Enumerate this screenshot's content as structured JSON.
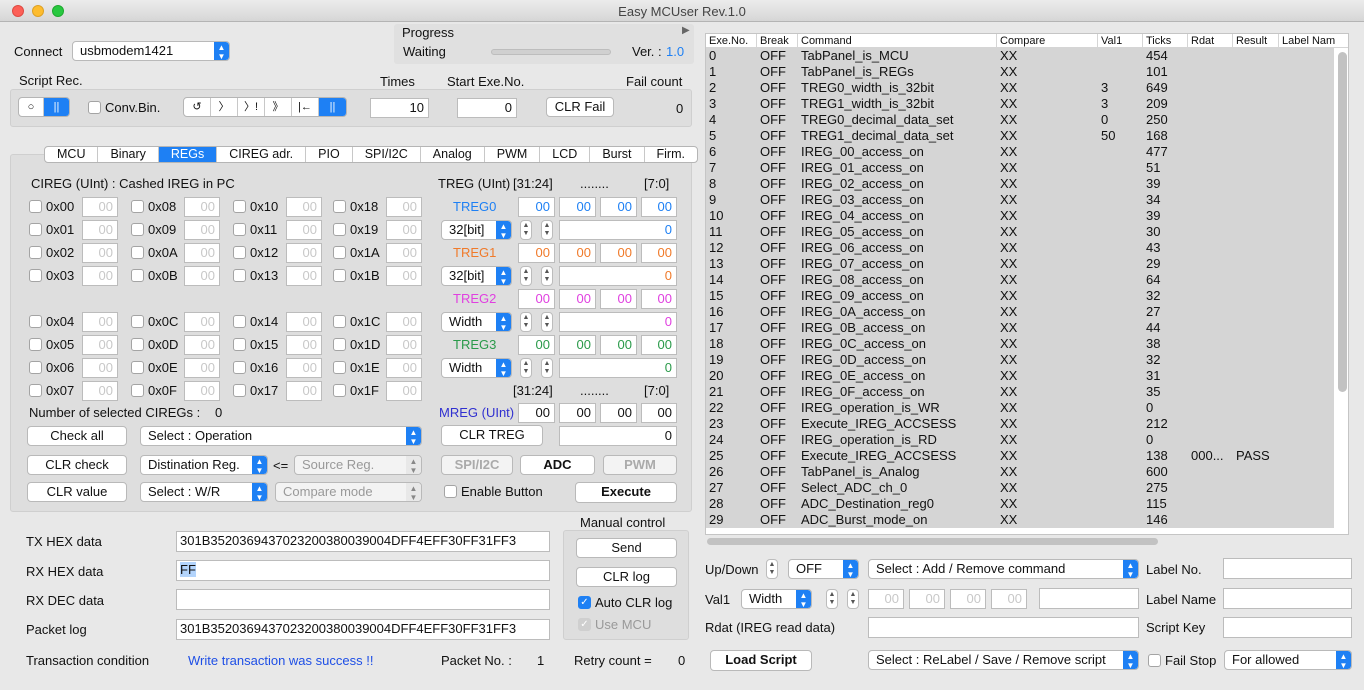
{
  "window": {
    "title": "Easy MCUser Rev.1.0"
  },
  "connect": {
    "label": "Connect",
    "port": "usbmodem1421"
  },
  "progress": {
    "label": "Progress",
    "status": "Waiting",
    "version_label": "Ver. :",
    "version": "1.0"
  },
  "script_rec": {
    "label": "Script Rec.",
    "conv_bin": "Conv.Bin.",
    "seg1": [
      "○",
      "||"
    ],
    "seg2": [
      "↺",
      "〉",
      "〉!",
      "》",
      "|←",
      "||"
    ]
  },
  "times": {
    "label": "Times",
    "value": "10"
  },
  "start_exe": {
    "label": "Start Exe.No.",
    "value": "0"
  },
  "fail": {
    "label": "Fail count",
    "clr": "CLR Fail",
    "value": "0"
  },
  "tabs": [
    "MCU",
    "Binary",
    "REGs",
    "CIREG adr.",
    "PIO",
    "SPI/I2C",
    "Analog",
    "PWM",
    "LCD",
    "Burst",
    "Firm."
  ],
  "cireg": {
    "title": "CIREG (UInt) : Cashed IREG in PC",
    "col0": [
      "0x00",
      "0x01",
      "0x02",
      "0x03",
      "0x04",
      "0x05",
      "0x06",
      "0x07"
    ],
    "col1": [
      "0x08",
      "0x09",
      "0x0A",
      "0x0B",
      "0x0C",
      "0x0D",
      "0x0E",
      "0x0F"
    ],
    "col2": [
      "0x10",
      "0x11",
      "0x12",
      "0x13",
      "0x14",
      "0x15",
      "0x16",
      "0x17"
    ],
    "col3": [
      "0x18",
      "0x19",
      "0x1A",
      "0x1B",
      "0x1C",
      "0x1D",
      "0x1E",
      "0x1F"
    ],
    "cell_value": "00",
    "selected_label": "Number of selected CIREGs :",
    "selected_count": "0"
  },
  "treg": {
    "title": "TREG (UInt)",
    "range_hi": "[31:24]",
    "dots": "........",
    "range_lo": "[7:0]",
    "treg0": {
      "label": "TREG0",
      "color": "#1e80f4",
      "width": "32[bit]",
      "bytes": [
        "00",
        "00",
        "00",
        "00"
      ],
      "dec": "0"
    },
    "treg1": {
      "label": "TREG1",
      "color": "#f07a2a",
      "width": "32[bit]",
      "bytes": [
        "00",
        "00",
        "00",
        "00"
      ],
      "dec": "0"
    },
    "treg2": {
      "label": "TREG2",
      "color": "#e040e0",
      "width": "Width",
      "bytes": [
        "00",
        "00",
        "00",
        "00"
      ],
      "dec": "0"
    },
    "treg3": {
      "label": "TREG3",
      "color": "#2a9a4a",
      "width": "Width",
      "bytes": [
        "00",
        "00",
        "00",
        "00"
      ],
      "dec": "0"
    },
    "mreg": {
      "label": "MREG (UInt)",
      "color": "#3030d0",
      "bytes": [
        "00",
        "00",
        "00",
        "00"
      ],
      "dec": "0"
    },
    "clr_treg": "CLR TREG"
  },
  "actions": {
    "check_all": "Check all",
    "select_op": "Select : Operation",
    "clr_check": "CLR check",
    "dest_reg": "Distination Reg.",
    "arrow": "<=",
    "source_reg": "Source Reg.",
    "clr_value": "CLR value",
    "select_wr": "Select : W/R",
    "compare_mode": "Compare mode",
    "spi_i2c": "SPI/I2C",
    "adc": "ADC",
    "pwm": "PWM",
    "enable_button": "Enable Button",
    "execute": "Execute"
  },
  "comm": {
    "tx_label": "TX HEX data",
    "tx": "301B3520369437023200380039004DFF4EFF30FF31FF3",
    "rx_label": "RX HEX data",
    "rx": "FF",
    "rxdec_label": "RX DEC data",
    "rxdec": "",
    "packet_label": "Packet log",
    "packet": "301B3520369437023200380039004DFF4EFF30FF31FF3",
    "trans_label": "Transaction condition",
    "trans": "Write transaction was success !!",
    "packet_no_label": "Packet No. :",
    "packet_no": "1",
    "retry_label": "Retry count  =",
    "retry": "0"
  },
  "manual": {
    "title": "Manual control",
    "send": "Send",
    "clr_log": "CLR log",
    "auto_clr": "Auto CLR log",
    "use_mcu": "Use MCU"
  },
  "table": {
    "headers": [
      "Exe.No.",
      "Break",
      "Command",
      "Compare",
      "Val1",
      "Ticks",
      "Rdat",
      "Result",
      "Label Nam"
    ],
    "rows": [
      [
        "0",
        "OFF",
        "TabPanel_is_MCU",
        "XX",
        "",
        "454",
        "",
        ""
      ],
      [
        "1",
        "OFF",
        "TabPanel_is_REGs",
        "XX",
        "",
        "101",
        "",
        ""
      ],
      [
        "2",
        "OFF",
        "TREG0_width_is_32bit",
        "XX",
        "3",
        "649",
        "",
        ""
      ],
      [
        "3",
        "OFF",
        "TREG1_width_is_32bit",
        "XX",
        "3",
        "209",
        "",
        ""
      ],
      [
        "4",
        "OFF",
        "TREG0_decimal_data_set",
        "XX",
        "0",
        "250",
        "",
        ""
      ],
      [
        "5",
        "OFF",
        "TREG1_decimal_data_set",
        "XX",
        "50",
        "168",
        "",
        ""
      ],
      [
        "6",
        "OFF",
        "IREG_00_access_on",
        "XX",
        "",
        "477",
        "",
        ""
      ],
      [
        "7",
        "OFF",
        "IREG_01_access_on",
        "XX",
        "",
        "51",
        "",
        ""
      ],
      [
        "8",
        "OFF",
        "IREG_02_access_on",
        "XX",
        "",
        "39",
        "",
        ""
      ],
      [
        "9",
        "OFF",
        "IREG_03_access_on",
        "XX",
        "",
        "34",
        "",
        ""
      ],
      [
        "10",
        "OFF",
        "IREG_04_access_on",
        "XX",
        "",
        "39",
        "",
        ""
      ],
      [
        "11",
        "OFF",
        "IREG_05_access_on",
        "XX",
        "",
        "30",
        "",
        ""
      ],
      [
        "12",
        "OFF",
        "IREG_06_access_on",
        "XX",
        "",
        "43",
        "",
        ""
      ],
      [
        "13",
        "OFF",
        "IREG_07_access_on",
        "XX",
        "",
        "29",
        "",
        ""
      ],
      [
        "14",
        "OFF",
        "IREG_08_access_on",
        "XX",
        "",
        "64",
        "",
        ""
      ],
      [
        "15",
        "OFF",
        "IREG_09_access_on",
        "XX",
        "",
        "32",
        "",
        ""
      ],
      [
        "16",
        "OFF",
        "IREG_0A_access_on",
        "XX",
        "",
        "27",
        "",
        ""
      ],
      [
        "17",
        "OFF",
        "IREG_0B_access_on",
        "XX",
        "",
        "44",
        "",
        ""
      ],
      [
        "18",
        "OFF",
        "IREG_0C_access_on",
        "XX",
        "",
        "38",
        "",
        ""
      ],
      [
        "19",
        "OFF",
        "IREG_0D_access_on",
        "XX",
        "",
        "32",
        "",
        ""
      ],
      [
        "20",
        "OFF",
        "IREG_0E_access_on",
        "XX",
        "",
        "31",
        "",
        ""
      ],
      [
        "21",
        "OFF",
        "IREG_0F_access_on",
        "XX",
        "",
        "35",
        "",
        ""
      ],
      [
        "22",
        "OFF",
        "IREG_operation_is_WR",
        "XX",
        "",
        "0",
        "",
        ""
      ],
      [
        "23",
        "OFF",
        "Execute_IREG_ACCSESS",
        "XX",
        "",
        "212",
        "",
        ""
      ],
      [
        "24",
        "OFF",
        "IREG_operation_is_RD",
        "XX",
        "",
        "0",
        "",
        ""
      ],
      [
        "25",
        "OFF",
        "Execute_IREG_ACCSESS",
        "XX",
        "",
        "138",
        "000...",
        "PASS"
      ],
      [
        "26",
        "OFF",
        "TabPanel_is_Analog",
        "XX",
        "",
        "600",
        "",
        ""
      ],
      [
        "27",
        "OFF",
        "Select_ADC_ch_0",
        "XX",
        "",
        "275",
        "",
        ""
      ],
      [
        "28",
        "OFF",
        "ADC_Destination_reg0",
        "XX",
        "",
        "115",
        "",
        ""
      ],
      [
        "29",
        "OFF",
        "ADC_Burst_mode_on",
        "XX",
        "",
        "146",
        "",
        ""
      ]
    ]
  },
  "bottom": {
    "updown_label": "Up/Down",
    "break_sel": "OFF",
    "cmd_sel": "Select : Add / Remove command",
    "label_no": "Label No.",
    "val1_label": "Val1",
    "val1_sel": "Width",
    "val_bytes": [
      "00",
      "00",
      "00",
      "00"
    ],
    "label_name": "Label Name",
    "rdat_label": "Rdat (IREG read data)",
    "script_key": "Script Key",
    "load_script": "Load Script",
    "relabel": "Select : ReLabel / Save / Remove script",
    "fail_stop": "Fail Stop",
    "for_allowed": "For allowed"
  }
}
